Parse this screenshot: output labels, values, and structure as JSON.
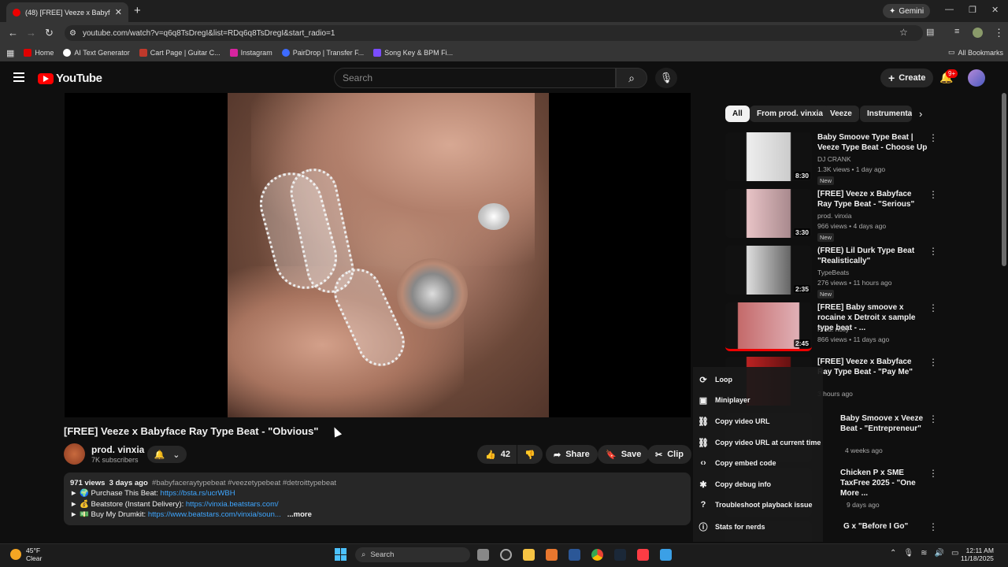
{
  "browser": {
    "tab_title": "(48) [FREE] Veeze x Babyface Ray Type Beat",
    "tab_close": "✕",
    "new_tab": "+",
    "gemini_label": "Gemini",
    "url": "youtube.com/watch?v=q6q8TsDregI&list=RDq6q8TsDregI&start_radio=1",
    "bookmarks": [
      {
        "label": "Home",
        "color": "#e00000"
      },
      {
        "label": "AI Text Generator",
        "color": "#ffffff"
      },
      {
        "label": "Cart Page | Guitar C...",
        "color": "#c0392b"
      },
      {
        "label": "Instagram",
        "color": "#d6249f"
      },
      {
        "label": "PairDrop | Transfer F...",
        "color": "#3d6bff"
      },
      {
        "label": "Song Key & BPM Fi...",
        "color": "#7a4cff"
      }
    ],
    "all_bookmarks": "All Bookmarks"
  },
  "header": {
    "logo_text": "YouTube",
    "search_placeholder": "Search",
    "create_label": "Create",
    "notification_count": "9+"
  },
  "video": {
    "title": "[FREE] Veeze x Babyface Ray Type Beat - \"Obvious\"",
    "channel": "prod. vinxia",
    "subscribers": "7K subscribers",
    "likes": "42",
    "share_label": "Share",
    "save_label": "Save",
    "clip_label": "Clip",
    "views": "971 views",
    "age": "3 days ago",
    "tags": "#babyfaceraytypebeat #veezetypebeat #detroittypebeat",
    "desc_lines": [
      {
        "prefix": "► 🌍 Purchase This Beat: ",
        "link": "https://bsta.rs/ucrWBH"
      },
      {
        "prefix": "► 💰 Beatstore (Instant Delivery): ",
        "link": "https://vinxia.beatstars.com/"
      },
      {
        "prefix": "► 💵 Buy My Drumkit: ",
        "link": "https://www.beatstars.com/vinxia/soun..."
      }
    ],
    "more_label": "...more"
  },
  "chips": [
    "All",
    "From prod. vinxia",
    "Veeze",
    "Instrumenta"
  ],
  "recommendations": [
    {
      "title": "Baby Smoove Type Beat | Veeze Type Beat - Choose Up",
      "channel": "DJ CRANK",
      "meta": "1.3K views • 1 day ago",
      "duration": "8:30",
      "badge": "New"
    },
    {
      "title": "[FREE] Veeze x Babyface Ray Type Beat - \"Serious\"",
      "channel": "prod. vinxia",
      "meta": "966 views • 4 days ago",
      "duration": "3:30",
      "badge": "New"
    },
    {
      "title": "(FREE) Lil Durk Type Beat \"Realistically\"",
      "channel": "TypeBeats",
      "meta": "276 views • 11 hours ago",
      "duration": "2:35",
      "badge": "New"
    },
    {
      "title": "[FREE] Baby smoove x rocaine x Detroit x sample type beat - ...",
      "channel": "Prod. n3lly",
      "meta": "866 views • 11 days ago",
      "duration": "2:45",
      "badge": ""
    },
    {
      "title": "[FREE] Veeze x Babyface Ray Type Beat - \"Pay Me\"",
      "channel": "",
      "meta": "3 hours ago",
      "duration": "",
      "badge": ""
    },
    {
      "title": "Baby Smoove x Veeze Beat - \"Entrepreneur\"",
      "channel": "",
      "meta": "4 weeks ago",
      "duration": "",
      "badge": ""
    },
    {
      "title": "Chicken P x SME TaxFree 2025 - \"One More ...",
      "channel": "",
      "meta": "9 days ago",
      "duration": "",
      "badge": ""
    },
    {
      "title": "G x \"Before I Go\"",
      "channel": "",
      "meta": "",
      "duration": "",
      "badge": ""
    }
  ],
  "context_menu": [
    {
      "label": "Loop",
      "icon": "loop-icon",
      "glyph": "⟳"
    },
    {
      "label": "Miniplayer",
      "icon": "miniplayer-icon",
      "glyph": "▣"
    },
    {
      "label": "Copy video URL",
      "icon": "link-icon",
      "glyph": "⛓"
    },
    {
      "label": "Copy video URL at current time",
      "icon": "link-icon",
      "glyph": "⛓"
    },
    {
      "label": "Copy embed code",
      "icon": "code-icon",
      "glyph": "‹›"
    },
    {
      "label": "Copy debug info",
      "icon": "bug-icon",
      "glyph": "✱"
    },
    {
      "label": "Troubleshoot playback issue",
      "icon": "help-icon",
      "glyph": "?"
    },
    {
      "label": "Stats for nerds",
      "icon": "info-icon",
      "glyph": "ⓘ"
    }
  ],
  "taskbar": {
    "weather_temp": "45°F",
    "weather_desc": "Clear",
    "search_label": "Search",
    "time": "12:11 AM",
    "date": "11/18/2025"
  }
}
